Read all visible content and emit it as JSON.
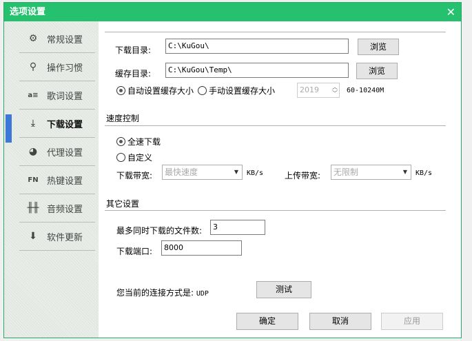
{
  "title": "选项设置",
  "sidebar": {
    "items": [
      {
        "label": "常规设置",
        "icon": "gear-icon",
        "glyph": "⚙"
      },
      {
        "label": "操作习惯",
        "icon": "pin-icon",
        "glyph": "⚲"
      },
      {
        "label": "歌词设置",
        "icon": "lyrics-icon",
        "glyph": "a≡"
      },
      {
        "label": "下载设置",
        "icon": "download-icon",
        "glyph": "⤓"
      },
      {
        "label": "代理设置",
        "icon": "globe-icon",
        "glyph": "◕"
      },
      {
        "label": "热键设置",
        "icon": "hotkey-icon",
        "glyph": "FN"
      },
      {
        "label": "音频设置",
        "icon": "equalizer-icon",
        "glyph": "╫╫"
      },
      {
        "label": "软件更新",
        "icon": "update-icon",
        "glyph": "⬇"
      }
    ]
  },
  "download": {
    "dir_label": "下载目录:",
    "dir_value": "C:\\KuGou\\",
    "browse1": "浏览",
    "cache_label": "缓存目录:",
    "cache_value": "C:\\KuGou\\Temp\\",
    "browse2": "浏览",
    "auto_cache": "自动设置缓存大小",
    "manual_cache": "手动设置缓存大小",
    "cache_size": "2019",
    "cache_range": "60-10240M"
  },
  "speed": {
    "heading": "速度控制",
    "full": "全速下载",
    "custom": "自定义",
    "down_label": "下载带宽:",
    "down_value": "最快速度",
    "unit1": "KB/s",
    "up_label": "上传带宽:",
    "up_value": "无限制",
    "unit2": "KB/s"
  },
  "other": {
    "heading": "其它设置",
    "max_label": "最多同时下载的文件数:",
    "max_value": "3",
    "port_label": "下载端口:",
    "port_value": "8000",
    "conn_label": "您当前的连接方式是:",
    "conn_value": "UDP",
    "test": "测试"
  },
  "footer": {
    "ok": "确定",
    "cancel": "取消",
    "apply": "应用"
  }
}
